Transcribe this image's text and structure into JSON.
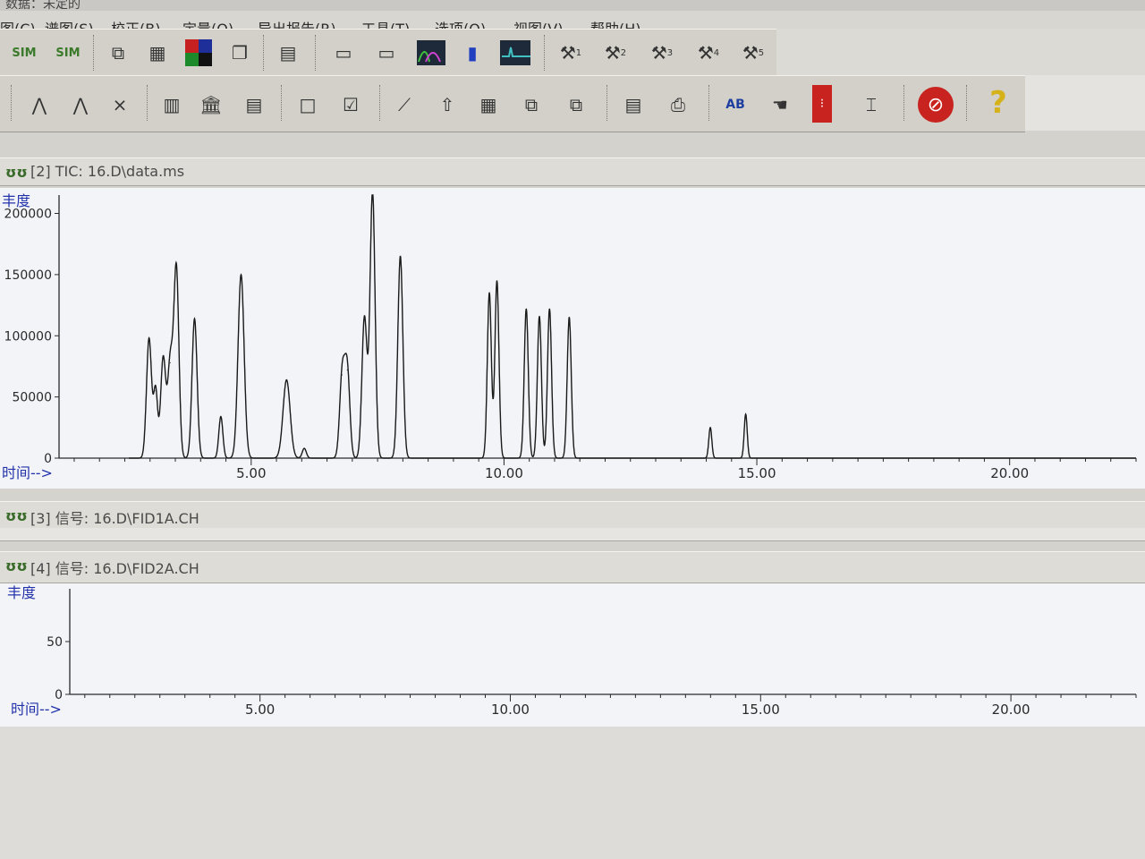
{
  "window": {
    "title_fragment": "数据：未定的"
  },
  "menu": [
    "图(C)",
    "谱图(S)",
    "校正(B)",
    "定量(Q)",
    "导出报告(R)",
    "工具(T)",
    "选项(O)",
    "视图(V)",
    "帮助(H)"
  ],
  "toolbar1": {
    "buttons": [
      {
        "icon": "sim-scan-icon",
        "glyph": "SIM"
      },
      {
        "icon": "sim-icon",
        "glyph": "SIM"
      },
      {
        "icon": "copy-pages-icon",
        "glyph": "⧉"
      },
      {
        "icon": "grid-select-icon",
        "glyph": "▦"
      },
      {
        "icon": "color-quadrant-icon",
        "glyph": "■"
      },
      {
        "icon": "window-stack-icon",
        "glyph": "❐"
      },
      {
        "icon": "document-icon",
        "glyph": "▤"
      },
      {
        "icon": "report-card-icon",
        "glyph": "▭"
      },
      {
        "icon": "report-edit-icon",
        "glyph": "▭"
      },
      {
        "icon": "peak-curves-icon",
        "glyph": "∿"
      },
      {
        "icon": "bar-peaks-icon",
        "glyph": "▮"
      },
      {
        "icon": "signal-monitor-icon",
        "glyph": "▬"
      },
      {
        "icon": "hammer-1-icon",
        "glyph": "⚒",
        "num": "1"
      },
      {
        "icon": "hammer-2-icon",
        "glyph": "⚒",
        "num": "2"
      },
      {
        "icon": "hammer-3-icon",
        "glyph": "⚒",
        "num": "3"
      },
      {
        "icon": "hammer-4-icon",
        "glyph": "⚒",
        "num": "4"
      },
      {
        "icon": "hammer-5-icon",
        "glyph": "⚒",
        "num": "5"
      }
    ]
  },
  "toolbar2": {
    "buttons": [
      {
        "icon": "integrate-icon",
        "glyph": "⋀"
      },
      {
        "icon": "integrate-alt-icon",
        "glyph": "⋀"
      },
      {
        "icon": "xy-table-icon",
        "glyph": "⨯"
      },
      {
        "icon": "bar-spectrum-icon",
        "glyph": "▥"
      },
      {
        "icon": "library-icon",
        "glyph": "🏛"
      },
      {
        "icon": "library-document-icon",
        "glyph": "▤"
      },
      {
        "icon": "blank-page-icon",
        "glyph": "□"
      },
      {
        "icon": "checklist-icon",
        "glyph": "☑"
      },
      {
        "icon": "chart-edit-icon",
        "glyph": "⟋"
      },
      {
        "icon": "chart-upload-icon",
        "glyph": "⇧"
      },
      {
        "icon": "table-grid-icon",
        "glyph": "▦"
      },
      {
        "icon": "copy-list-icon",
        "glyph": "⧉"
      },
      {
        "icon": "folder-docs-icon",
        "glyph": "⧉"
      },
      {
        "icon": "report-table-icon",
        "glyph": "▤"
      },
      {
        "icon": "print-report-icon",
        "glyph": "⎙"
      },
      {
        "icon": "ab-compare-icon",
        "glyph": "AB"
      },
      {
        "icon": "hand-transfer-icon",
        "glyph": "☚"
      },
      {
        "icon": "xyz-list-icon",
        "glyph": "⁝"
      },
      {
        "icon": "cursor-text-icon",
        "glyph": "⌶"
      },
      {
        "icon": "stop-icon",
        "glyph": "⊘"
      },
      {
        "icon": "help-icon",
        "glyph": "?"
      }
    ]
  },
  "panel2": {
    "header": "[2] TIC: 16.D\\data.ms",
    "ylabel": "丰度",
    "xlabel": "时间-->"
  },
  "panel3": {
    "header": "[3] 信号: 16.D\\FID1A.CH"
  },
  "panel4": {
    "header": "[4] 信号: 16.D\\FID2A.CH",
    "ylabel": "丰度",
    "xlabel": "时间-->"
  },
  "chart_data": [
    {
      "type": "line",
      "title": "[2] TIC: 16.D\\data.ms",
      "xlabel": "时间-->",
      "ylabel": "丰度",
      "xlim": [
        1.2,
        22.5
      ],
      "ylim": [
        0,
        215000
      ],
      "xticks": [
        5.0,
        10.0,
        15.0,
        20.0
      ],
      "xtick_labels": [
        "5.00",
        "10.00",
        "15.00",
        "20.00"
      ],
      "yticks": [
        0,
        50000,
        100000,
        150000,
        200000
      ],
      "ytick_labels": [
        "0",
        "50000",
        "100000",
        "150000",
        "200000"
      ],
      "peaks": [
        {
          "rt": 2.98,
          "height": 98000,
          "width": 0.05
        },
        {
          "rt": 3.11,
          "height": 55000,
          "width": 0.04
        },
        {
          "rt": 3.26,
          "height": 82000,
          "width": 0.05
        },
        {
          "rt": 3.4,
          "height": 78000,
          "width": 0.05
        },
        {
          "rt": 3.52,
          "height": 155000,
          "width": 0.05
        },
        {
          "rt": 3.88,
          "height": 114000,
          "width": 0.05
        },
        {
          "rt": 4.4,
          "height": 34000,
          "width": 0.04
        },
        {
          "rt": 4.8,
          "height": 150000,
          "width": 0.06
        },
        {
          "rt": 5.7,
          "height": 64000,
          "width": 0.07
        },
        {
          "rt": 6.05,
          "height": 8000,
          "width": 0.04
        },
        {
          "rt": 6.8,
          "height": 68000,
          "width": 0.05
        },
        {
          "rt": 6.9,
          "height": 72000,
          "width": 0.05
        },
        {
          "rt": 7.24,
          "height": 115000,
          "width": 0.05
        },
        {
          "rt": 7.4,
          "height": 218000,
          "width": 0.05
        },
        {
          "rt": 7.95,
          "height": 165000,
          "width": 0.05
        },
        {
          "rt": 9.71,
          "height": 135000,
          "width": 0.04
        },
        {
          "rt": 9.86,
          "height": 145000,
          "width": 0.04
        },
        {
          "rt": 10.44,
          "height": 122000,
          "width": 0.04
        },
        {
          "rt": 10.7,
          "height": 116000,
          "width": 0.04
        },
        {
          "rt": 10.9,
          "height": 122000,
          "width": 0.04
        },
        {
          "rt": 11.29,
          "height": 115000,
          "width": 0.04
        },
        {
          "rt": 14.08,
          "height": 25000,
          "width": 0.03
        },
        {
          "rt": 14.78,
          "height": 36000,
          "width": 0.03
        }
      ]
    },
    {
      "type": "line",
      "title": "[4] 信号: 16.D\\FID2A.CH",
      "xlabel": "时间-->",
      "ylabel": "丰度",
      "xlim": [
        1.2,
        22.5
      ],
      "ylim": [
        0,
        100
      ],
      "xticks": [
        5.0,
        10.0,
        15.0,
        20.0
      ],
      "xtick_labels": [
        "5.00",
        "10.00",
        "15.00",
        "20.00"
      ],
      "yticks": [
        0,
        50
      ],
      "ytick_labels": [
        "0",
        "50"
      ],
      "values": []
    }
  ],
  "colors": {
    "trace": "#1a1a1a",
    "axis": "#2a2a2a",
    "label_blue": "#2233aa",
    "plot_bg": "#f3f4f8",
    "toolbar_bg": "#d2d0c9"
  }
}
